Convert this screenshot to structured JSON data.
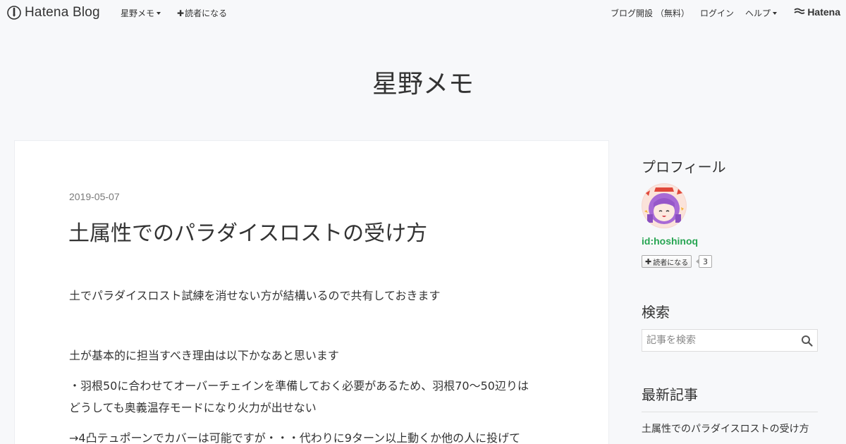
{
  "topbar": {
    "brand": "Hatena Blog",
    "blog_menu": "星野メモ",
    "subscribe": "読者になる",
    "open_blog": "ブログ開設 （無料）",
    "login": "ログイン",
    "help": "ヘルプ",
    "hatena": "Hatena"
  },
  "blog": {
    "title": "星野メモ"
  },
  "article": {
    "date": "2019-05-07",
    "title": "土属性でのパラダイスロストの受け方",
    "paragraphs": [
      "土でパラダイスロスト試練を消せない方が結構いるので共有しておきます",
      "土が基本的に担当すべき理由は以下かなあと思います",
      "・羽根50に合わせてオーバーチェインを準備しておく必要があるため、羽根70〜50辺りは",
      "どうしても奥義温存モードになり火力が出せない",
      "→4凸テュポーンでカバーは可能ですが・・・代わりに9ターン以上動くか他の人に投げて"
    ]
  },
  "sidebar": {
    "profile_heading": "プロフィール",
    "profile_id": "id:hoshinoq",
    "subscribe_label": "読者になる",
    "subscriber_count": "3",
    "search_heading": "検索",
    "search_placeholder": "記事を検索",
    "recent_heading": "最新記事",
    "recent_items": [
      "土属性でのパラダイスロストの受け方"
    ]
  },
  "colors": {
    "accent_green": "#27a552",
    "background": "#f7f8fa"
  }
}
